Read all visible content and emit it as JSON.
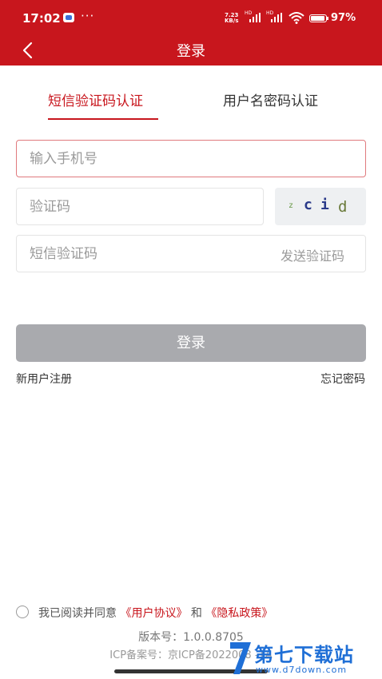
{
  "status_bar": {
    "time": "17:02",
    "dots": "···",
    "net_speed_value": "7.23",
    "net_speed_unit": "KB/s",
    "sim1_label": "HD",
    "sim2_label": "HD",
    "battery_percent": "97%"
  },
  "header": {
    "title": "登录"
  },
  "tabs": [
    {
      "label": "短信验证码认证",
      "active": true
    },
    {
      "label": "用户名密码认证",
      "active": false
    }
  ],
  "form": {
    "phone_placeholder": "输入手机号",
    "code_placeholder": "验证码",
    "captcha_chars": [
      "z",
      "c",
      "i",
      "d"
    ],
    "sms_placeholder": "短信验证码",
    "send_code_label": "发送验证码",
    "login_button": "登录"
  },
  "links": {
    "register": "新用户注册",
    "forgot_password": "忘记密码"
  },
  "agreement": {
    "prefix": "我已阅读并同意",
    "user_agreement": "《用户协议》",
    "and": "和",
    "privacy_policy": "《隐私政策》"
  },
  "footer": {
    "version": "版本号：1.0.0.8705",
    "icp": "ICP备案号：京ICP备2022008      -1A"
  },
  "watermark": {
    "title": "第七下载站",
    "url": "www.d7down.com"
  },
  "colors": {
    "brand_red": "#c8161d",
    "disabled_button": "#a9aaae",
    "watermark_blue": "#1f6fd6"
  }
}
